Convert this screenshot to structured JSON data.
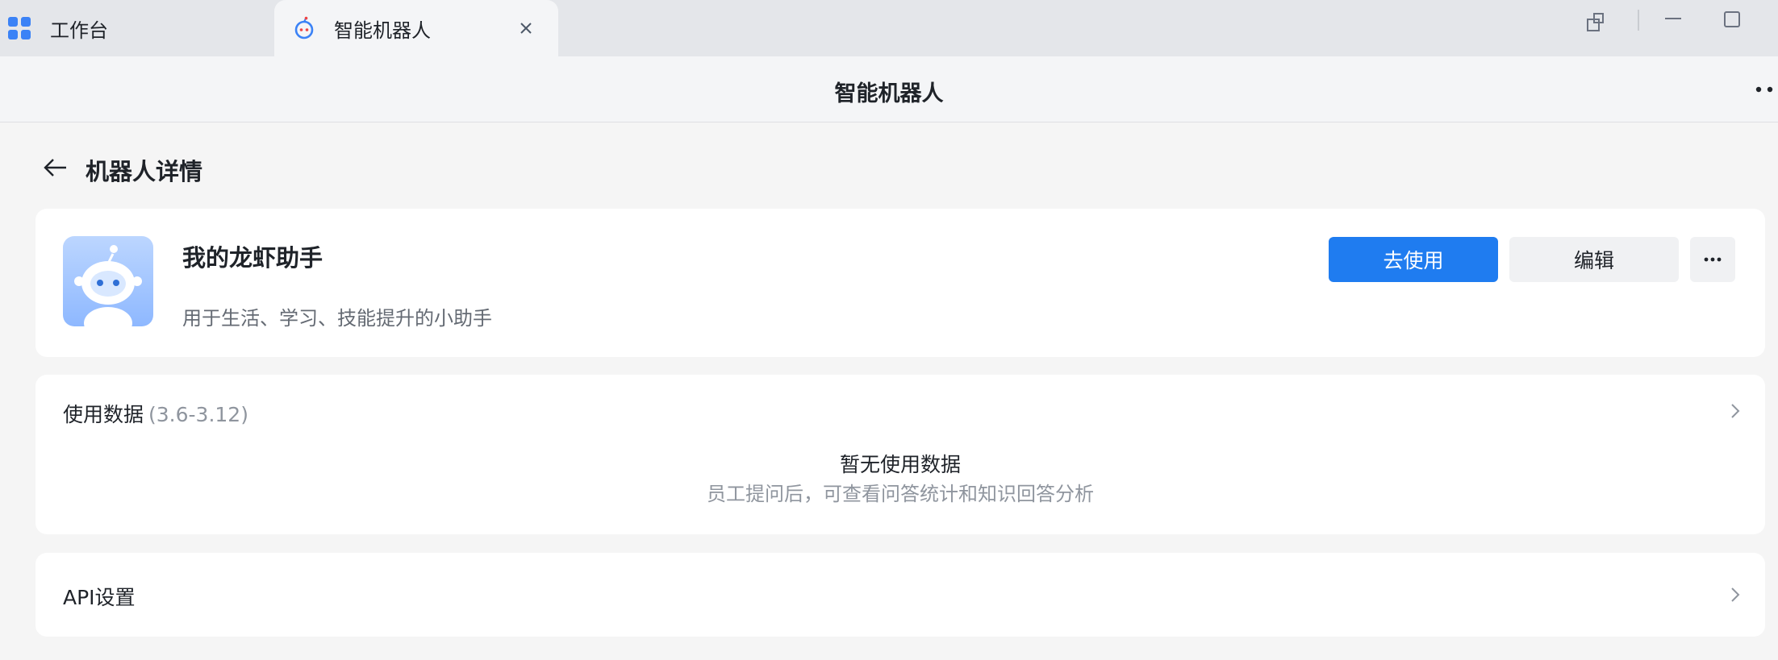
{
  "tabs": {
    "workbench": "工作台",
    "bot": "智能机器人"
  },
  "header": {
    "title": "智能机器人"
  },
  "page": {
    "title": "机器人详情"
  },
  "bot": {
    "name": "我的龙虾助手",
    "description": "用于生活、学习、技能提升的小助手"
  },
  "actions": {
    "use_label": "去使用",
    "edit_label": "编辑"
  },
  "usage": {
    "title": "使用数据",
    "range": "(3.6-3.12)",
    "empty_title": "暂无使用数据",
    "empty_hint": "员工提问后，可查看问答统计和知识回答分析"
  },
  "api": {
    "title": "API设置"
  },
  "colors": {
    "primary": "#1f7cf0",
    "page_bg": "#f5f5f5",
    "tabbar_bg": "#e4e6ea"
  },
  "icons": [
    "workbench-grid-icon",
    "bot-tab-icon",
    "close-icon",
    "restore-window-icon",
    "minimize-icon",
    "maximize-icon",
    "more-dots-icon",
    "back-arrow-icon",
    "chevron-right-icon",
    "bot-avatar"
  ]
}
